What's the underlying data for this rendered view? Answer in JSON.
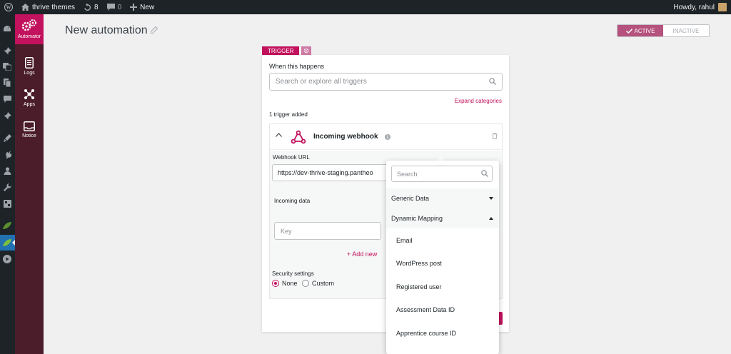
{
  "admin_bar": {
    "site_name": "thrive themes",
    "updates_count": "8",
    "comments_count": "0",
    "new_label": "New",
    "greeting": "Howdy, rahul"
  },
  "automator_nav": [
    {
      "label": "Automator",
      "icon": "automator-gears-icon"
    },
    {
      "label": "Logs",
      "icon": "logs-icon"
    },
    {
      "label": "Apps",
      "icon": "apps-icon"
    },
    {
      "label": "Notice",
      "icon": "notice-icon"
    }
  ],
  "header": {
    "title": "New automation",
    "active_label": "ACTIVE",
    "inactive_label": "INACTIVE",
    "state": "active"
  },
  "trigger": {
    "tag_label": "TRIGGER",
    "when_label": "When this happens",
    "search_placeholder": "Search or explore all triggers",
    "expand_label": "Expand categories",
    "count_label": "1 trigger added",
    "card_title": "Incoming webhook",
    "webhook_url_label": "Webhook URL",
    "webhook_url_value": "https://dev-thrive-staging.pantheo",
    "incoming_data_label": "Incoming data",
    "key_placeholder": "Key",
    "add_new_label": "+ Add new",
    "security_label": "Security settings",
    "security_options": [
      "None",
      "Custom"
    ],
    "security_selected": "None"
  },
  "dropdown": {
    "search_placeholder": "Search",
    "groups": [
      {
        "label": "Generic Data",
        "expanded": false
      },
      {
        "label": "Dynamic Mapping",
        "expanded": true
      }
    ],
    "items": [
      "Email",
      "WordPress post",
      "Registered user",
      "Assessment Data ID",
      "Apprentice course ID"
    ]
  },
  "colors": {
    "brand": "#c2125d",
    "active_toggle": "#b5527e",
    "automator_sidebar": "#4b1d2b",
    "admin_dark": "#1d2327"
  }
}
